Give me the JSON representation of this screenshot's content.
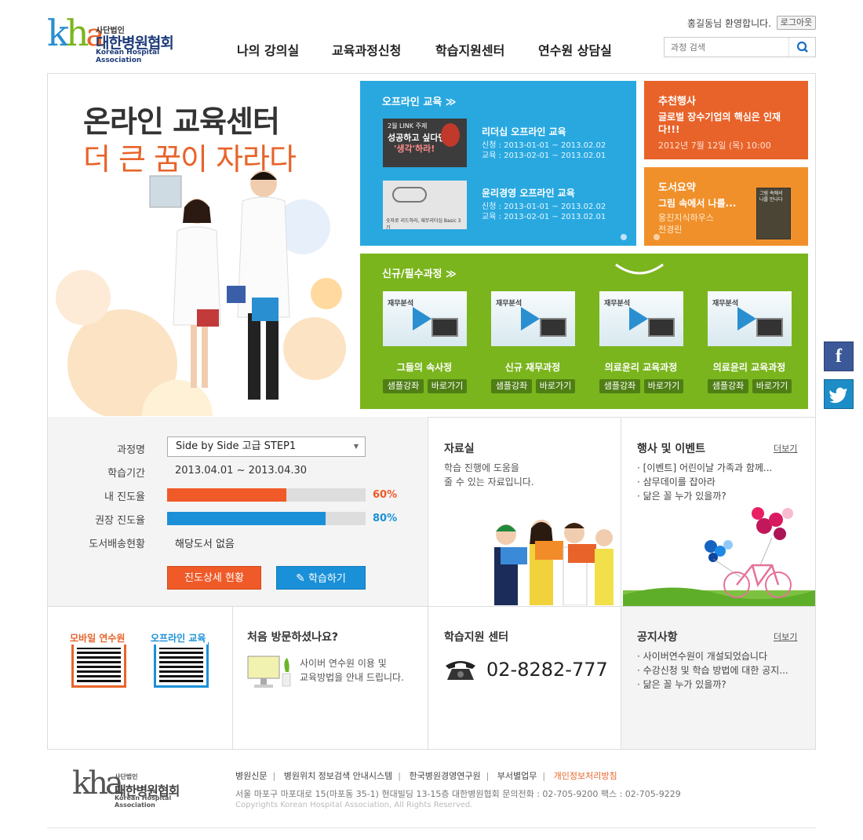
{
  "header": {
    "logo": {
      "sub": "사단법인",
      "main": "대한병원협회",
      "en": "Korean Hospital Association",
      "tiny": "Korean Hospital Association"
    },
    "welcome": "홍길동님 환영합니다.",
    "logout": "로그아웃",
    "nav": [
      "나의 강의실",
      "교육과정신청",
      "학습지원센터",
      "연수원 상담실"
    ],
    "search": {
      "placeholder": "과정 검색",
      "icon": "search-icon"
    }
  },
  "hero": {
    "line1": "온라인 교육센터",
    "line2": "더 큰 꿈이 자라다"
  },
  "offline": {
    "title": "오프라인 교육 ≫",
    "items": [
      {
        "title": "리더십 오프라인 교육",
        "apply": "신청 : 2013-01-01 ~ 2013.02.02",
        "edu": "교육 : 2013-02-01 ~ 2013.02.01",
        "thumb_text1": "2월 LINK 주제",
        "thumb_text2": "성공하고 싶다면",
        "thumb_text3": "'생각'하라!"
      },
      {
        "title": "윤리경영 오프라인 교육",
        "apply": "신청 : 2013-01-01 ~ 2013.02.02",
        "edu": "교육 : 2013-02-01 ~ 2013.02.01",
        "thumb_text1": "숫자로 리드하라, 재무리더십 Basic 3기"
      }
    ]
  },
  "event": {
    "title": "추천행사",
    "headline": "글로벌 장수기업의 핵심은 인재다!!!",
    "date": "2012년 7월 12일 (목) 10:00"
  },
  "book": {
    "title": "도서요약",
    "headline": "그림 속에서 나를...",
    "publisher": "웅진지식하우스",
    "author": "전경린",
    "cover_text": "그림 속에서 나를 만나다"
  },
  "new_courses": {
    "title": "신규/필수과정 ≫",
    "items": [
      {
        "label": "재무분석",
        "name": "그들의 속사정",
        "sample": "샘플강좌",
        "go": "바로가기"
      },
      {
        "label": "재무분석",
        "name": "신규 재무과정",
        "sample": "샘플강좌",
        "go": "바로가기"
      },
      {
        "label": "재무분석",
        "name": "의료윤리 교육과정",
        "sample": "샘플강좌",
        "go": "바로가기"
      },
      {
        "label": "재무분석",
        "name": "의료윤리 교육과정",
        "sample": "샘플강좌",
        "go": "바로가기"
      }
    ]
  },
  "study": {
    "labels": {
      "course": "과정명",
      "period": "학습기간",
      "my_progress": "내 진도율",
      "rec_progress": "권장 진도율",
      "book_delivery": "도서배송현황"
    },
    "course_selected": "Side by Side 고급 STEP1",
    "period": "2013.04.01 ~ 2013.04.30",
    "my_progress": 0.6,
    "my_progress_text": "60%",
    "rec_progress": 0.8,
    "rec_progress_text": "80%",
    "book_status": "해당도서 없음",
    "btn_detail": "진도상세 현황",
    "btn_study": "학습하기",
    "colors": {
      "my": "#f05a28",
      "rec": "#1a90d8"
    }
  },
  "archive": {
    "title": "자료실",
    "desc1": "학습 진행에 도움을",
    "desc2": "줄 수 있는 자료입니다."
  },
  "events": {
    "title": "행사 및 이벤트",
    "more": "더보기",
    "items": [
      "[이벤트] 어린이날 가족과 함께...",
      "삼무데이를 잡아라",
      "닮은 꼴 누가 있을까?"
    ]
  },
  "qr": {
    "mobile": "모바일 연수원",
    "offline": "오프라인 교육",
    "colors": {
      "mobile": "#e8632a",
      "offline": "#1a90d8"
    }
  },
  "first_visit": {
    "title": "처음 방문하셨나요?",
    "desc1": "사이버 연수원 이용 및",
    "desc2": "교육방법을 안내 드립니다."
  },
  "support": {
    "title": "학습지원 센터",
    "phone": "02-8282-777"
  },
  "notice": {
    "title": "공지사항",
    "more": "더보기",
    "items": [
      "사이버연수원이 개설되었습니다",
      "수강신청 및 학습 방법에 대한 공지...",
      "닮은 꼴 누가 있을까?"
    ]
  },
  "footer": {
    "links": [
      "병원신문",
      "병원위치 정보검색 안내시스템",
      "한국병원경영연구원",
      "부서별업무",
      "개인정보처리방침"
    ],
    "address": "서울 마포구 마포대로 15(마포동 35-1) 현대빌딩 13-15층 대한병원협회 문의전화 : 02-705-9200  팩스 : 02-705-9229",
    "copyright": "Copyrights Korean Hospital Association, All Rights Reserved."
  },
  "sns": {
    "facebook": "f",
    "icons": [
      "facebook-icon",
      "twitter-icon"
    ]
  }
}
